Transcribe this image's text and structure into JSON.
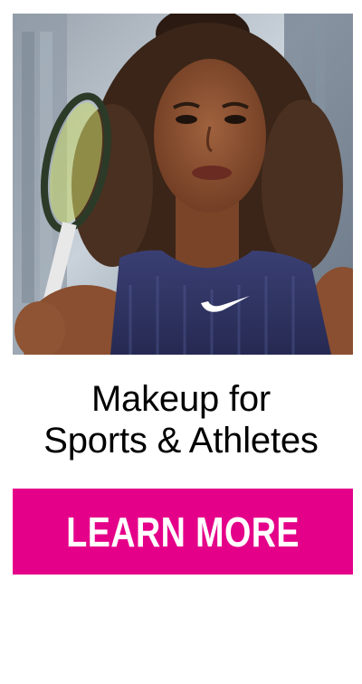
{
  "promo": {
    "headline_line1": "Makeup for",
    "headline_line2": "Sports & Athletes",
    "cta_label": "LEARN MORE",
    "image_alt": "Athlete holding a tennis racket"
  },
  "colors": {
    "cta_background": "#e5008a",
    "cta_text": "#ffffff",
    "headline_text": "#000000",
    "page_background": "#ffffff"
  }
}
